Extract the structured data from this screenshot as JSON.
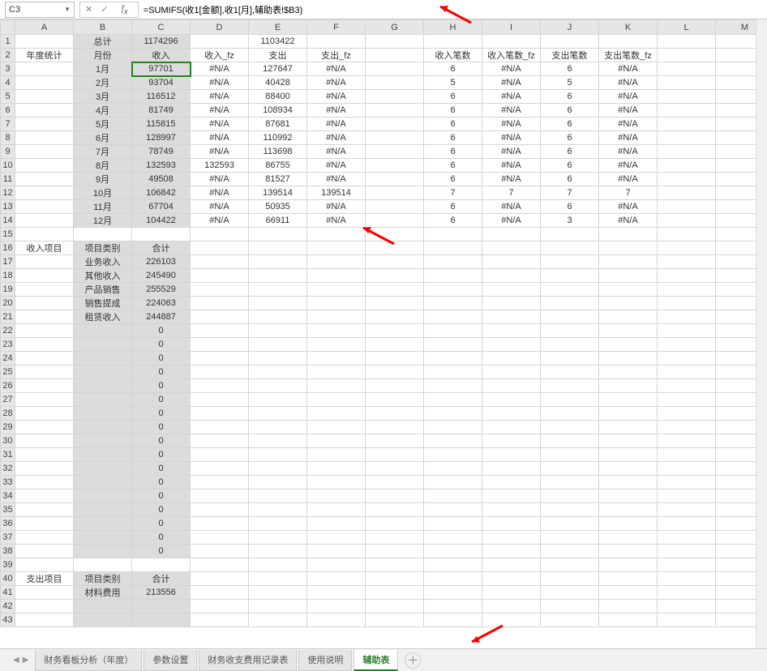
{
  "nameBox": "C3",
  "formula": "=SUMIFS(收1[金额],收1[月],辅助表!$B3)",
  "columns": [
    "A",
    "B",
    "C",
    "D",
    "E",
    "F",
    "G",
    "H",
    "I",
    "J",
    "K",
    "L",
    "M"
  ],
  "topRow": {
    "B": "总计",
    "C": "1174296",
    "E": "1103422"
  },
  "headerRow": {
    "A": "年度统计",
    "B": "月份",
    "C": "收入",
    "D": "收入_fz",
    "E": "支出",
    "F": "支出_fz",
    "H": "收入笔数",
    "I": "收入笔数_fz",
    "J": "支出笔数",
    "K": "支出笔数_fz"
  },
  "months": [
    {
      "B": "1月",
      "C": "97701",
      "D": "#N/A",
      "E": "127647",
      "F": "#N/A",
      "H": "6",
      "I": "#N/A",
      "J": "6",
      "K": "#N/A"
    },
    {
      "B": "2月",
      "C": "93704",
      "D": "#N/A",
      "E": "40428",
      "F": "#N/A",
      "H": "5",
      "I": "#N/A",
      "J": "5",
      "K": "#N/A"
    },
    {
      "B": "3月",
      "C": "116512",
      "D": "#N/A",
      "E": "88400",
      "F": "#N/A",
      "H": "6",
      "I": "#N/A",
      "J": "6",
      "K": "#N/A"
    },
    {
      "B": "4月",
      "C": "81749",
      "D": "#N/A",
      "E": "108934",
      "F": "#N/A",
      "H": "6",
      "I": "#N/A",
      "J": "6",
      "K": "#N/A"
    },
    {
      "B": "5月",
      "C": "115815",
      "D": "#N/A",
      "E": "87681",
      "F": "#N/A",
      "H": "6",
      "I": "#N/A",
      "J": "6",
      "K": "#N/A"
    },
    {
      "B": "6月",
      "C": "128997",
      "D": "#N/A",
      "E": "110992",
      "F": "#N/A",
      "H": "6",
      "I": "#N/A",
      "J": "6",
      "K": "#N/A"
    },
    {
      "B": "7月",
      "C": "78749",
      "D": "#N/A",
      "E": "113698",
      "F": "#N/A",
      "H": "6",
      "I": "#N/A",
      "J": "6",
      "K": "#N/A"
    },
    {
      "B": "8月",
      "C": "132593",
      "D": "132593",
      "E": "86755",
      "F": "#N/A",
      "H": "6",
      "I": "#N/A",
      "J": "6",
      "K": "#N/A"
    },
    {
      "B": "9月",
      "C": "49508",
      "D": "#N/A",
      "E": "81527",
      "F": "#N/A",
      "H": "6",
      "I": "#N/A",
      "J": "6",
      "K": "#N/A"
    },
    {
      "B": "10月",
      "C": "106842",
      "D": "#N/A",
      "E": "139514",
      "F": "139514",
      "H": "7",
      "I": "7",
      "J": "7",
      "K": "7"
    },
    {
      "B": "11月",
      "C": "67704",
      "D": "#N/A",
      "E": "50935",
      "F": "#N/A",
      "H": "6",
      "I": "#N/A",
      "J": "6",
      "K": "#N/A"
    },
    {
      "B": "12月",
      "C": "104422",
      "D": "#N/A",
      "E": "66911",
      "F": "#N/A",
      "H": "6",
      "I": "#N/A",
      "J": "3",
      "K": "#N/A"
    }
  ],
  "incomeHeader": {
    "A": "收入项目",
    "B": "项目类别",
    "C": "合计"
  },
  "incomeRows": [
    {
      "B": "业务收入",
      "C": "226103"
    },
    {
      "B": "其他收入",
      "C": "245490"
    },
    {
      "B": "产品销售",
      "C": "255529"
    },
    {
      "B": "销售提成",
      "C": "224063"
    },
    {
      "B": "租赁收入",
      "C": "244887"
    }
  ],
  "zeroCount": 17,
  "zeroValue": "0",
  "expenseHeader": {
    "A": "支出项目",
    "B": "项目类别",
    "C": "合计"
  },
  "expenseRows": [
    {
      "B": "材料费用",
      "C": "213556"
    }
  ],
  "tabs": [
    "财务看板分析（年度）",
    "参数设置",
    "财务收支费用记录表",
    "使用说明",
    "辅助表"
  ],
  "activeTab": 4
}
